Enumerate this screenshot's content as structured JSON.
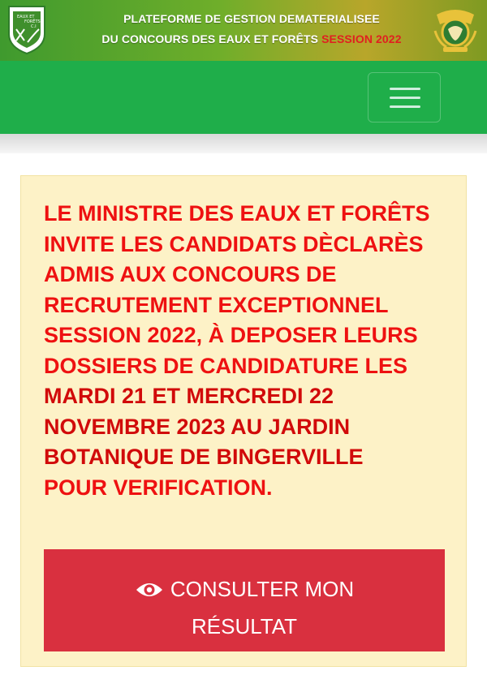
{
  "header": {
    "title_line1": "PLATEFORME DE GESTION DEMATERIALISEE",
    "title_line2": "DU CONCOURS DES EAUX ET FORÊTS",
    "session_label": "SESSION 2022",
    "logo_left_text": [
      "EAUX ET",
      "FORÊTS",
      "C.I"
    ]
  },
  "navbar": {
    "menu_icon": "hamburger-icon"
  },
  "notice": {
    "text_part1": "LE MINISTRE DES EAUX ET FORÊTS INVITE LES CANDIDATS DÈCLARÈS ADMIS AUX CONCOURS DE RECRUTEMENT EXCEPTIONNEL SESSION 2022, À DEPOSER LEURS DOSSIERS DE CANDIDATURE LES ",
    "text_highlight": "MARDI 21 ET MERCREDI 22 NOVEMBRE 2023 AU JARDIN BOTANIQUE DE BINGERVILLE",
    "text_part2": "POUR VERIFICATION."
  },
  "result_button": {
    "label_line1": "CONSULTER MON",
    "label_line2": "RÉSULTAT",
    "icon": "eye-icon"
  },
  "colors": {
    "navbar": "#1fae4a",
    "notice_bg": "#fdf2c7",
    "notice_text": "#ee1111",
    "button_bg": "#d9303f"
  }
}
